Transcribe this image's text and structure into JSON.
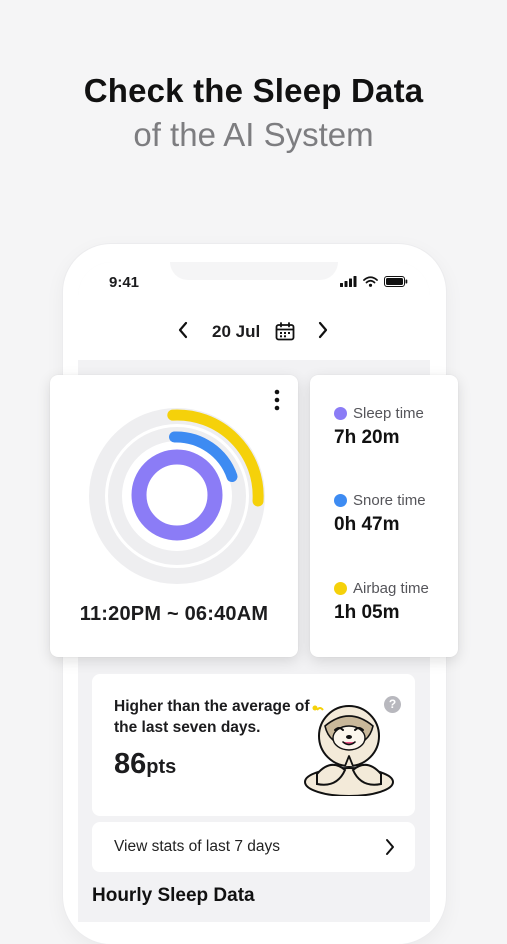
{
  "headline": {
    "title": "Check the Sleep Data",
    "subtitle": "of the AI System"
  },
  "status_bar": {
    "time": "9:41",
    "icons": [
      "signal-icon",
      "wifi-icon",
      "battery-icon"
    ]
  },
  "date_nav": {
    "date": "20 Jul",
    "prev_icon": "chevron-left-icon",
    "next_icon": "chevron-right-icon",
    "calendar_icon": "calendar-icon"
  },
  "sleep_chart": {
    "time_range": "11:20PM ~ 06:40AM",
    "colors": {
      "sleep": "#8b7cf6",
      "snore": "#3d8bf2",
      "airbag": "#f5d10a",
      "track": "#eeeef0"
    }
  },
  "stats": [
    {
      "label": "Sleep time",
      "value": "7h 20m",
      "color": "#8b7cf6"
    },
    {
      "label": "Snore time",
      "value": "0h 47m",
      "color": "#3d8bf2"
    },
    {
      "label": "Airbag time",
      "value": "1h 05m",
      "color": "#f5d10a"
    }
  ],
  "score": {
    "text": "Higher than the average of the last seven days.",
    "value": "86",
    "unit": "pts",
    "help": "?"
  },
  "weekly_link": {
    "label": "View stats of last 7 days"
  },
  "section": {
    "title": "Hourly Sleep Data"
  }
}
